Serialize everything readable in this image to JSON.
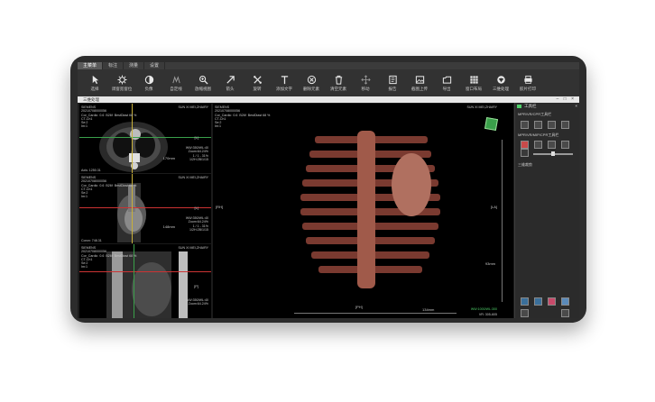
{
  "menu_tabs": [
    "主菜单",
    "标注",
    "测量",
    "设置"
  ],
  "toolbar": [
    {
      "label": "选择",
      "icon": "cursor-icon"
    },
    {
      "label": "调窗宽窗位",
      "icon": "window-level-icon"
    },
    {
      "label": "负像",
      "icon": "invert-icon"
    },
    {
      "label": "自定线",
      "icon": "custom-line-icon"
    },
    {
      "label": "放缩视图",
      "icon": "zoom-icon"
    },
    {
      "label": "箭头",
      "icon": "arrow-icon"
    },
    {
      "label": "旋转",
      "icon": "rotate-icon"
    },
    {
      "label": "添加文字",
      "icon": "text-icon"
    },
    {
      "label": "删除元素",
      "icon": "delete-element-icon"
    },
    {
      "label": "清空元素",
      "icon": "trash-icon"
    },
    {
      "label": "移动",
      "icon": "move-icon"
    },
    {
      "label": "报告",
      "icon": "report-icon"
    },
    {
      "label": "截图上传",
      "icon": "screenshot-upload-icon"
    },
    {
      "label": "导出",
      "icon": "export-icon"
    },
    {
      "label": "窗口布局",
      "icon": "layout-grid-icon"
    },
    {
      "label": "三维处理",
      "icon": "3d-process-icon"
    },
    {
      "label": "胶片打印",
      "icon": "print-icon"
    }
  ],
  "window_title": "三维处理",
  "viewports": {
    "axial": {
      "tl": "SIEMENS\n20210708000056\nCor_Cardio  0.6  B26f  BestDiast 68 %\nCT-Ch1\nSe:2\nIm:1",
      "tr": "SUN XI MEI,ZHAIRY",
      "mr": "WW:350/WL:40\nZoom:64.24%\n1 / 1 - 31%\n1/2H:2B/1/15",
      "right_marker": "[L]",
      "size": "170mm",
      "bl": "Axis: 1250.31"
    },
    "coronal": {
      "tl": "SIEMENS\n20210708000056\nCor_Cardio  0.6  B26f  BestDiast 68 %\nCT-Ch1\nSe:2\nIm:1",
      "tr": "SUN XI MEI,ZHAIRY",
      "mr": "WW:350/WL:40\nZoom:64.24%\n1 / 1 - 31%\n1/2H:2B/1/15",
      "right_marker": "[L]",
      "size": "148mm",
      "bl": "Coron: 748.31"
    },
    "sagittal": {
      "tl": "SIEMENS\n20210708000056\nCor_Cardio  0.6  B26f  BestDiast 68 %\nCT-Ch1\nSe:2\nIm:1",
      "tr": "SUN XI MEI,ZHAIRY",
      "mr": "WW:350/WL:40\nZoom:64.24%",
      "right_marker": "[P]"
    },
    "volume": {
      "tl": "SIEMENS\n20210708000056\nCor_Cardio  0.6  B26f  BestDiast 68 %\nCT-Ch1\nSe:2\nIm:1",
      "tr": "SUN XI MEI,ZHAIRY",
      "left_marker": "[RH]",
      "right_marker": "[LA]",
      "bottom_marker": "[PH]",
      "size_right": "93mm",
      "size_bottom": "134mm",
      "br_ww": "WW:1000/WL:300",
      "br_vr": "VR: 305-605"
    }
  },
  "panel": {
    "title": "工具栏",
    "sections": [
      "MPR/VR/CPR工具栏",
      "MPR/VR/MIP/CPR工具栏",
      "三维裁剪"
    ]
  },
  "colors": {
    "bone": "#a05a4a",
    "crosshair_red": "#cc3333",
    "crosshair_yellow": "#c8b03a",
    "crosshair_green": "#3aa04a",
    "highlight_green": "#4fd06a"
  }
}
